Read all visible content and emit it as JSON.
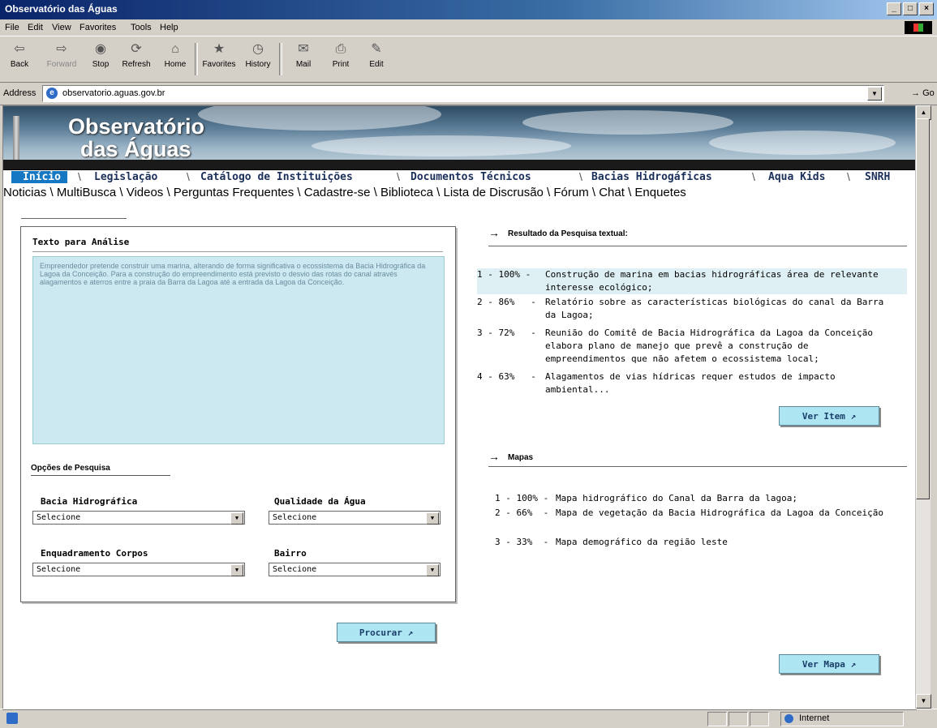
{
  "window": {
    "title": "Observatório das Águas"
  },
  "menu": [
    "File",
    "Edit",
    "View",
    "Favorites",
    "Tools",
    "Help"
  ],
  "toolbar": {
    "back": "Back",
    "forward": "Forward",
    "stop": "Stop",
    "refresh": "Refresh",
    "home": "Home",
    "favorites": "Favorites",
    "history": "History",
    "mail": "Mail",
    "print": "Print",
    "edit": "Edit"
  },
  "address": {
    "label": "Address",
    "url": "observatorio.aguas.gov.br",
    "go": "Go"
  },
  "banner": {
    "line1": "Observatório",
    "line2": "das Águas"
  },
  "nav_main": [
    "Início",
    "Legislação",
    "Catálogo de Instituições",
    "Documentos Técnicos",
    "Bacias Hidrogáficas",
    "Aqua Kids",
    "SNRH"
  ],
  "nav_secondary": "Noticias \\ MultiBusca \\ Videos \\ Perguntas Frequentes \\ Cadastre-se \\ Biblioteca \\ Lista de Discrusão \\ Fórum \\ Chat \\ Enquetes",
  "analysis": {
    "title": "Texto para Análise",
    "text": "Empreendedor pretende construir uma marina, alterando de forma significativa o ecossistema da Bacia Hidrográfica da Lagoa da Conceição. Para a construção do empreendimento está previsto o desvio das rotas do canal através alagamentos e aterros entre a praia da Barra da Lagoa até a entrada da Lagoa da Conceição."
  },
  "options": {
    "title": "Opções de Pesquisa",
    "bacia": {
      "label": "Bacia Hidrográfica",
      "value": "Selecione"
    },
    "qualidade": {
      "label": "Qualidade da Água",
      "value": "Selecione"
    },
    "enquadramento": {
      "label": "Enquadramento Corpos",
      "value": "Selecione"
    },
    "bairro": {
      "label": "Bairro",
      "value": "Selecione"
    }
  },
  "search_button": "Procurar ↗",
  "results": {
    "title": "Resultado da Pesquisa textual:",
    "items": [
      {
        "prefix": "1 - 100% -",
        "text": "Construção de marina em bacias hidrográficas área de relevante interesse ecológico;"
      },
      {
        "prefix": "2 - 86%   -",
        "text": "Relatório sobre as características biológicas do canal da Barra da Lagoa;"
      },
      {
        "prefix": "3 - 72%   -",
        "text": "Reunião do Comitê de Bacia Hidrográfica da Lagoa da Conceição elabora plano de manejo que prevê a construção de empreendimentos que não afetem o ecossistema local;"
      },
      {
        "prefix": "4 - 63%   -",
        "text": "Alagamentos de vias hídricas requer estudos de impacto ambiental..."
      }
    ],
    "button": "Ver Item ↗"
  },
  "maps": {
    "title": "Mapas",
    "items": [
      {
        "prefix": "1 - 100% -",
        "text": "Mapa hidrográfico do Canal da Barra da lagoa;"
      },
      {
        "prefix": "2 - 66%  -",
        "text": "Mapa de vegetação da Bacia Hidrográfica da Lagoa da Conceição"
      },
      {
        "prefix": "3 - 33%  -",
        "text": "Mapa demográfico da região leste"
      }
    ],
    "button": "Ver Mapa ↗"
  },
  "status": {
    "zone": "Internet"
  }
}
